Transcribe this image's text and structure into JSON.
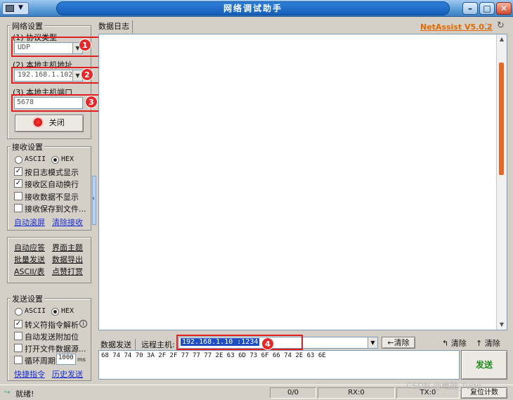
{
  "title": "网络调试助手",
  "brand": "NetAssist V5.0.2",
  "network": {
    "group_title": "网络设置",
    "protocol_label": "(1) 协议类型",
    "protocol_value": "UDP",
    "host_label": "(2) 本地主机地址",
    "host_value": "192.168.1.102",
    "port_label": "(3) 本地主机端口",
    "port_value": "5678",
    "close_button": "关闭"
  },
  "receive": {
    "group_title": "接收设置",
    "ascii": "ASCII",
    "hex": "HEX",
    "options": [
      {
        "label": "按日志模式显示",
        "checked": true
      },
      {
        "label": "接收区自动换行",
        "checked": true
      },
      {
        "label": "接收数据不显示",
        "checked": false
      },
      {
        "label": "接收保存到文件...",
        "checked": false
      }
    ],
    "auto_scroll": "自动滚屏",
    "clear_receive": "清除接收"
  },
  "tools": [
    "自动应答",
    "界面主题",
    "批量发送",
    "数据导出",
    "ASCII/表",
    "点赞打赏"
  ],
  "send": {
    "group_title": "发送设置",
    "ascii": "ASCII",
    "hex": "HEX",
    "options": [
      {
        "label": "转义符指令解析",
        "checked": true
      },
      {
        "label": "自动发送附加位",
        "checked": false
      },
      {
        "label": "打开文件数据源...",
        "checked": false
      },
      {
        "label": "循环周期",
        "checked": false
      }
    ],
    "cycle_value": "1000",
    "cycle_unit": "ms",
    "shortcut": "快捷指令",
    "history": "历史发送"
  },
  "tabs": {
    "log": "数据日志",
    "send": "数据发送"
  },
  "remote": {
    "label": "远程主机:",
    "value": "192.168.1.10 :1234"
  },
  "buttons": {
    "clear_arrow": "清除",
    "clear1": "清除",
    "clear2": "清除",
    "send": "发送"
  },
  "send_data": "68 74 74 70 3A 2F 2F 77 77 77 2E 63 6D 73 6F 66 74 2E 63 6E",
  "badges": [
    "1",
    "2",
    "3",
    "4"
  ],
  "status": {
    "ready": "就绪!",
    "count": "0/0",
    "rx": "RX:0",
    "tx": "TX:0",
    "reset": "复位计数"
  },
  "watermark": "CSDN @电脑_fuge"
}
